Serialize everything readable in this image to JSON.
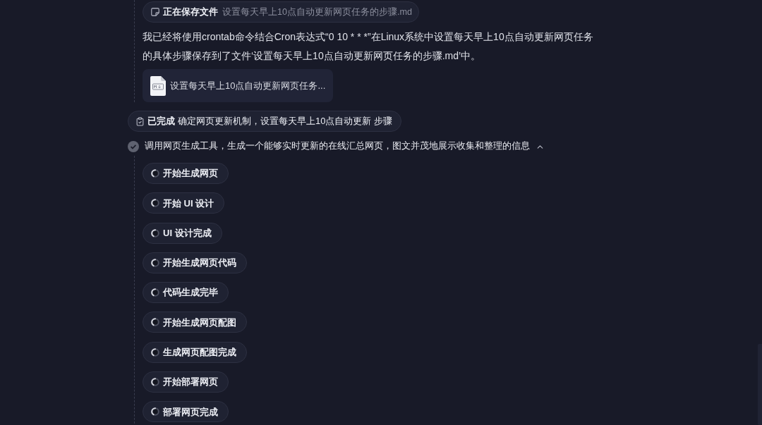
{
  "save_status": {
    "label": "正在保存文件",
    "file_name": "设置每天早上10点自动更新网页任务的步骤.md"
  },
  "message": "我已经将使用crontab命令结合Cron表达式“0 10 * * *”在Linux系统中设置每天早上10点自动更新网页任务的具体步骤保存到了文件‘设置每天早上10点自动更新网页任务的步骤.md’中。",
  "attachment": {
    "kind": "markdown",
    "name": "设置每天早上10点自动更新网页任务..."
  },
  "task": {
    "status": "已完成",
    "text": "确定网页更新机制，设置每天早上10点自动更新 步骤"
  },
  "step": {
    "title": "调用网页生成工具，生成一个能够实时更新的在线汇总网页，图文并茂地展示收集和整理的信息",
    "done": true,
    "expanded": true,
    "substeps": [
      {
        "label": "开始生成网页",
        "loading": true
      },
      {
        "label": "开始 UI 设计",
        "loading": true
      },
      {
        "label": "UI 设计完成",
        "loading": true
      },
      {
        "label": "开始生成网页代码",
        "loading": true
      },
      {
        "label": "代码生成完毕",
        "loading": true
      },
      {
        "label": "开始生成网页配图",
        "loading": true
      },
      {
        "label": "生成网页配图完成",
        "loading": true
      },
      {
        "label": "开始部署网页",
        "loading": true
      },
      {
        "label": "部署网页完成",
        "loading": true
      }
    ]
  }
}
